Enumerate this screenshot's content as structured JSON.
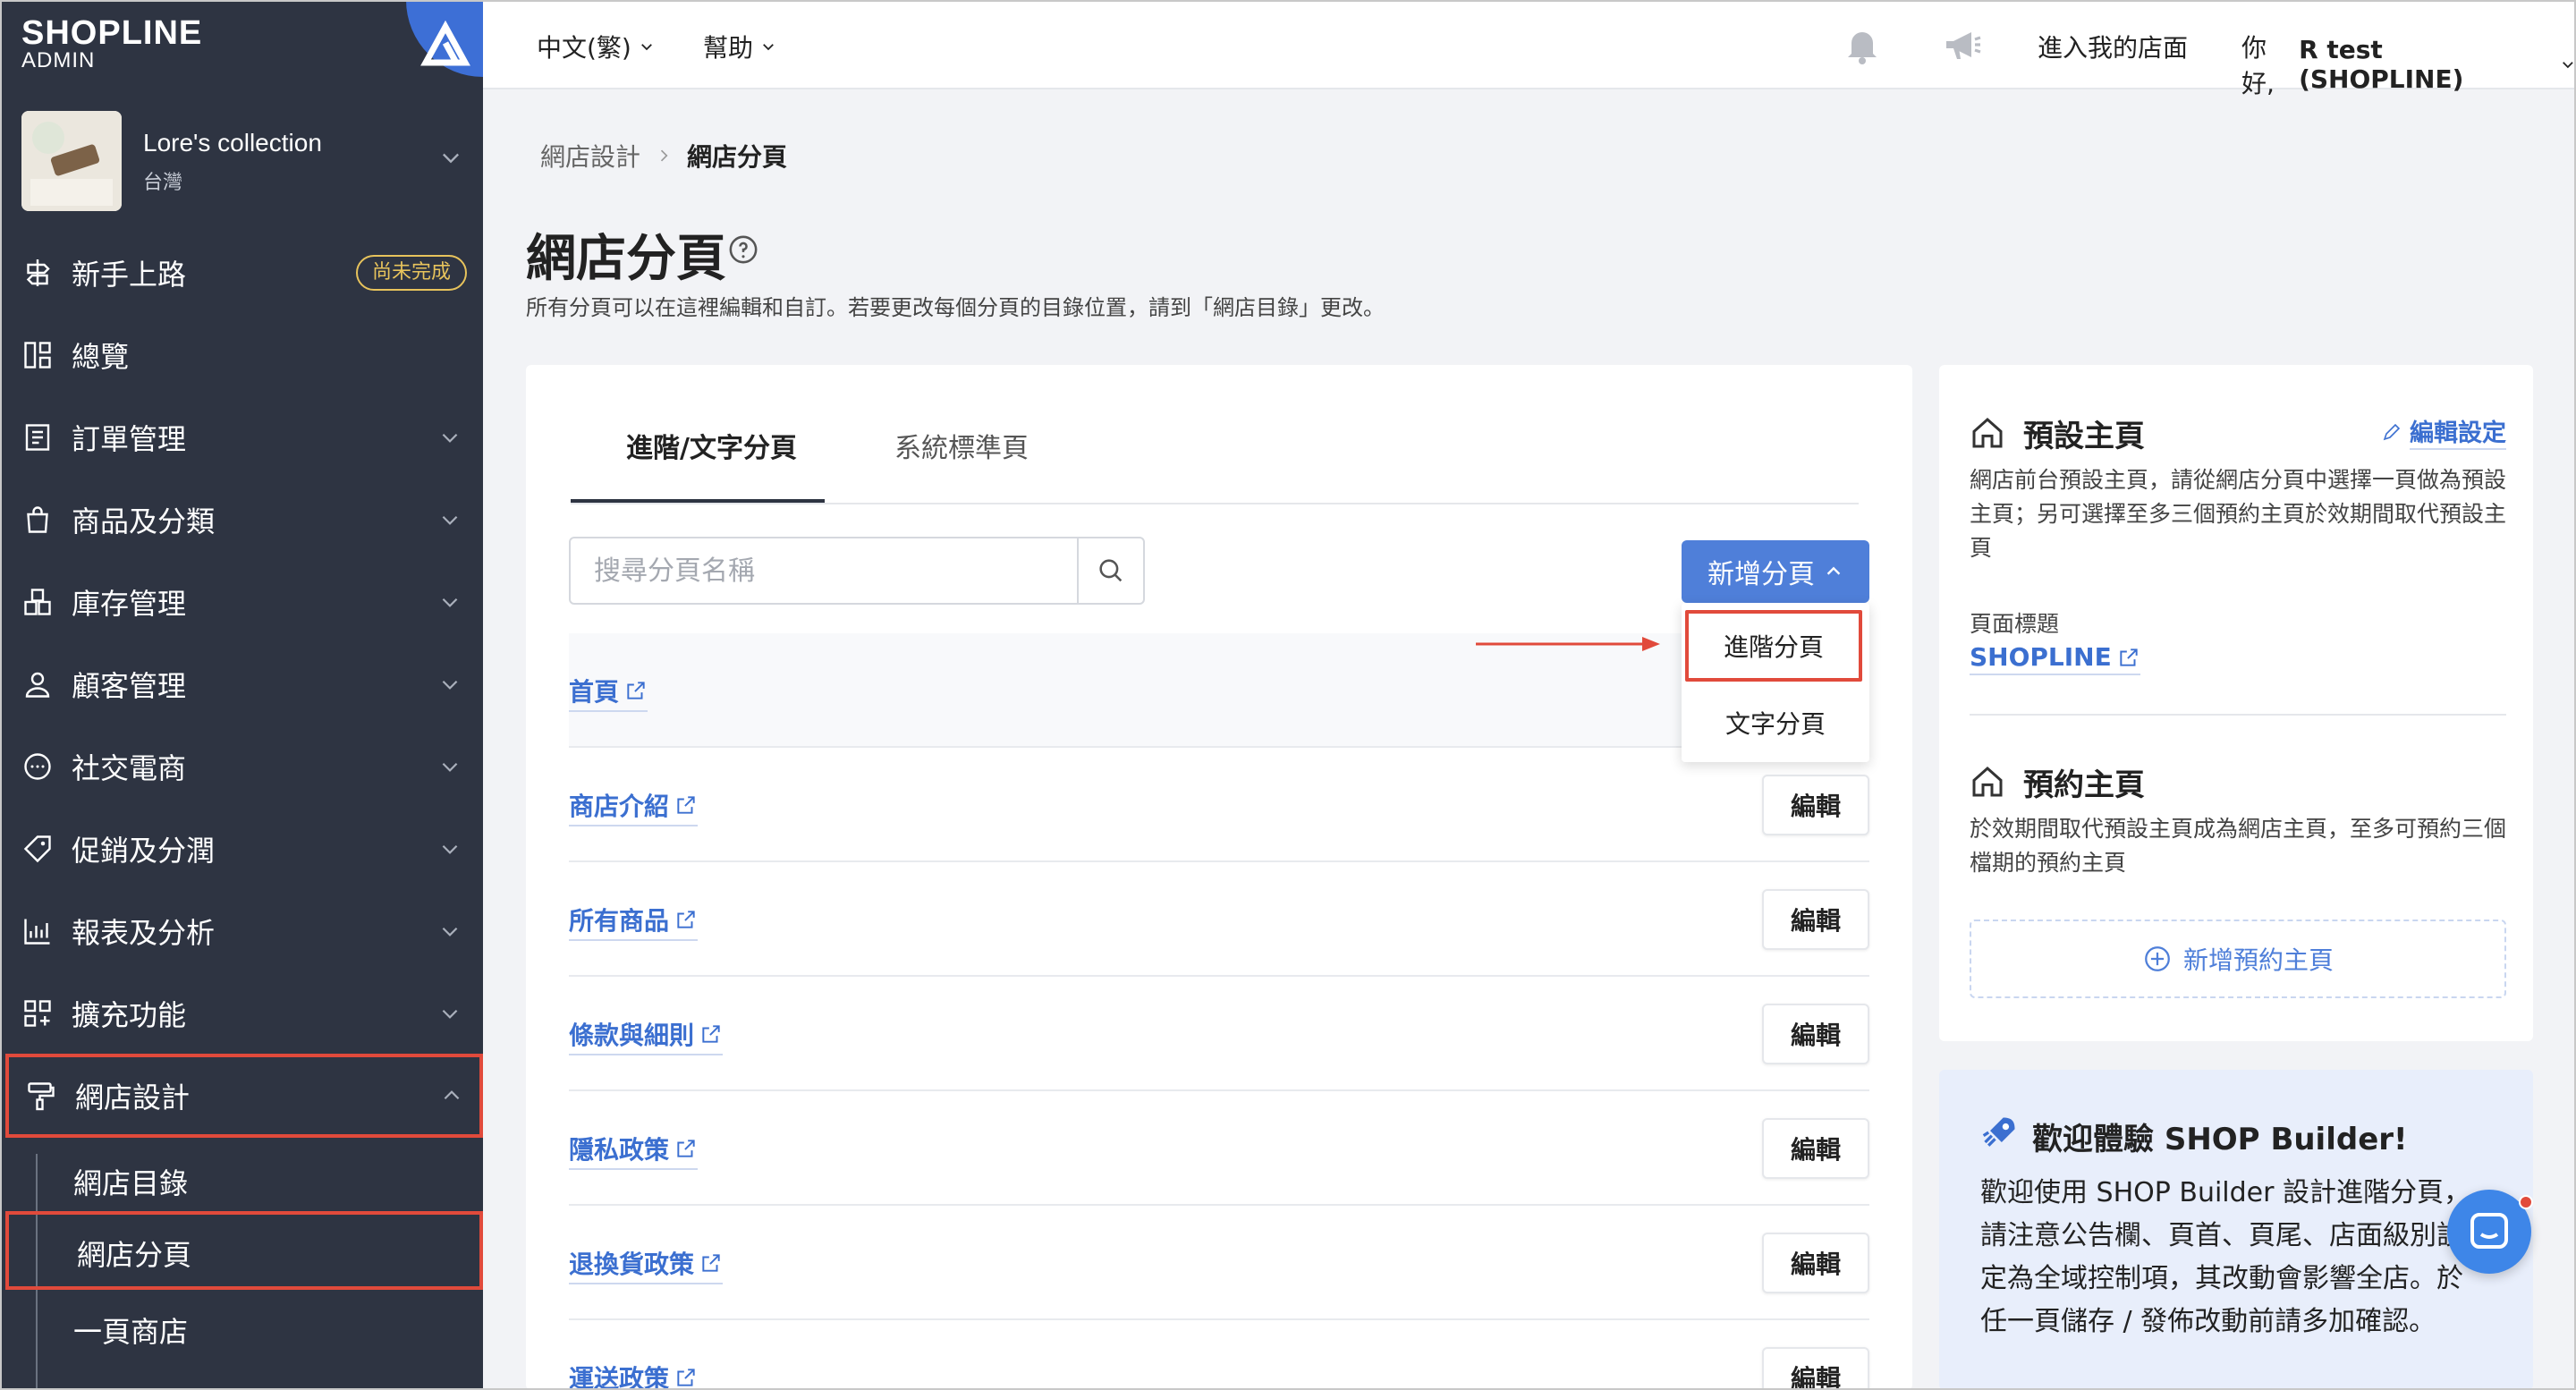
{
  "brand": {
    "logo": "SHOPLINE",
    "sub": "ADMIN"
  },
  "store": {
    "name": "Lore's collection",
    "region": "台灣"
  },
  "sidebar": {
    "items": [
      {
        "label": "新手上路",
        "icon": "signpost-icon",
        "badge": "尚未完成"
      },
      {
        "label": "總覽",
        "icon": "dashboard-icon"
      },
      {
        "label": "訂單管理",
        "icon": "order-icon"
      },
      {
        "label": "商品及分類",
        "icon": "bag-icon"
      },
      {
        "label": "庫存管理",
        "icon": "inventory-icon"
      },
      {
        "label": "顧客管理",
        "icon": "user-icon"
      },
      {
        "label": "社交電商",
        "icon": "chat-icon"
      },
      {
        "label": "促銷及分潤",
        "icon": "tag-icon"
      },
      {
        "label": "報表及分析",
        "icon": "report-icon"
      },
      {
        "label": "擴充功能",
        "icon": "apps-icon"
      },
      {
        "label": "網店設計",
        "icon": "paint-roller-icon"
      }
    ],
    "subitems": [
      {
        "label": "網店目錄"
      },
      {
        "label": "網店分頁"
      },
      {
        "label": "一頁商店"
      }
    ]
  },
  "topbar": {
    "language": "中文(繁)",
    "help": "幫助",
    "visit_store": "進入我的店面",
    "greeting_prefix": "你好, ",
    "user": "R test (SHOPLINE)"
  },
  "breadcrumb": {
    "parent": "網店設計",
    "current": "網店分頁"
  },
  "page": {
    "title": "網店分頁",
    "description": "所有分頁可以在這裡編輯和自訂。若要更改每個分頁的目錄位置，請到「網店目錄」更改。"
  },
  "tabs": [
    {
      "label": "進階/文字分頁"
    },
    {
      "label": "系統標準頁"
    }
  ],
  "search": {
    "placeholder": "搜尋分頁名稱"
  },
  "add_button": {
    "label": "新增分頁"
  },
  "dropdown": {
    "items": [
      {
        "label": "進階分頁"
      },
      {
        "label": "文字分頁"
      }
    ]
  },
  "rows": [
    {
      "name": "首頁",
      "edit": ""
    },
    {
      "name": "商店介紹",
      "edit": "編輯"
    },
    {
      "name": "所有商品",
      "edit": "編輯"
    },
    {
      "name": "條款與細則",
      "edit": "編輯"
    },
    {
      "name": "隱私政策",
      "edit": "編輯"
    },
    {
      "name": "退換貨政策",
      "edit": "編輯"
    },
    {
      "name": "運送政策",
      "edit": "編輯"
    }
  ],
  "default_home": {
    "title": "預設主頁",
    "edit_label": "編輯設定",
    "description": "網店前台預設主頁，請從網店分頁中選擇一頁做為預設主頁；另可選擇至多三個預約主頁於效期間取代預設主頁",
    "page_title_label": "頁面標題",
    "page_title_value": "SHOPLINE"
  },
  "scheduled_home": {
    "title": "預約主頁",
    "description": "於效期間取代預設主頁成為網店主頁，至多可預約三個檔期的預約主頁",
    "add_label": "新增預約主頁"
  },
  "welcome": {
    "title": "歡迎體驗 SHOP Builder!",
    "text": "歡迎使用 SHOP Builder 設計進階分頁，請注意公告欄、頁首、頁尾、店面級別設定為全域控制項，其改動會影響全店。於任一頁儲存 / 發佈改動前請多加確認。"
  },
  "colors": {
    "sidebar": "#2e3442",
    "accent": "#4f7fd9",
    "highlight": "#e14a3b",
    "badge": "#e7c35c"
  }
}
